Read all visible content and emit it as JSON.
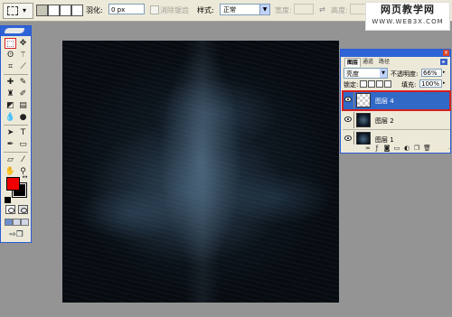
{
  "options_bar": {
    "feather_label": "羽化:",
    "feather_value": "0 px",
    "antialias_label": "消除锯齿",
    "style_label": "样式:",
    "style_value": "正常",
    "width_label": "宽度:",
    "height_label": "高度:",
    "swap_icon": "swap-icon"
  },
  "watermark": {
    "title": "网页教学网",
    "url": "WWW.WEB3X.COM"
  },
  "toolbox": {
    "foreground_color": "#ee0000",
    "background_color": "#000000"
  },
  "layers_panel": {
    "tabs": [
      {
        "label": "图层"
      },
      {
        "label": "通道"
      },
      {
        "label": "路径"
      }
    ],
    "blend_mode": "亮度",
    "opacity_label": "不透明度:",
    "opacity_value": "66%",
    "lock_label": "锁定:",
    "fill_label": "填充:",
    "fill_value": "100%",
    "layers": [
      {
        "name": "图层 4",
        "selected": true
      },
      {
        "name": "图层 2",
        "selected": false
      },
      {
        "name": "图层 1",
        "selected": false
      }
    ]
  },
  "colors": {
    "accent_blue": "#2f64d6",
    "selection_red": "#d32020"
  }
}
